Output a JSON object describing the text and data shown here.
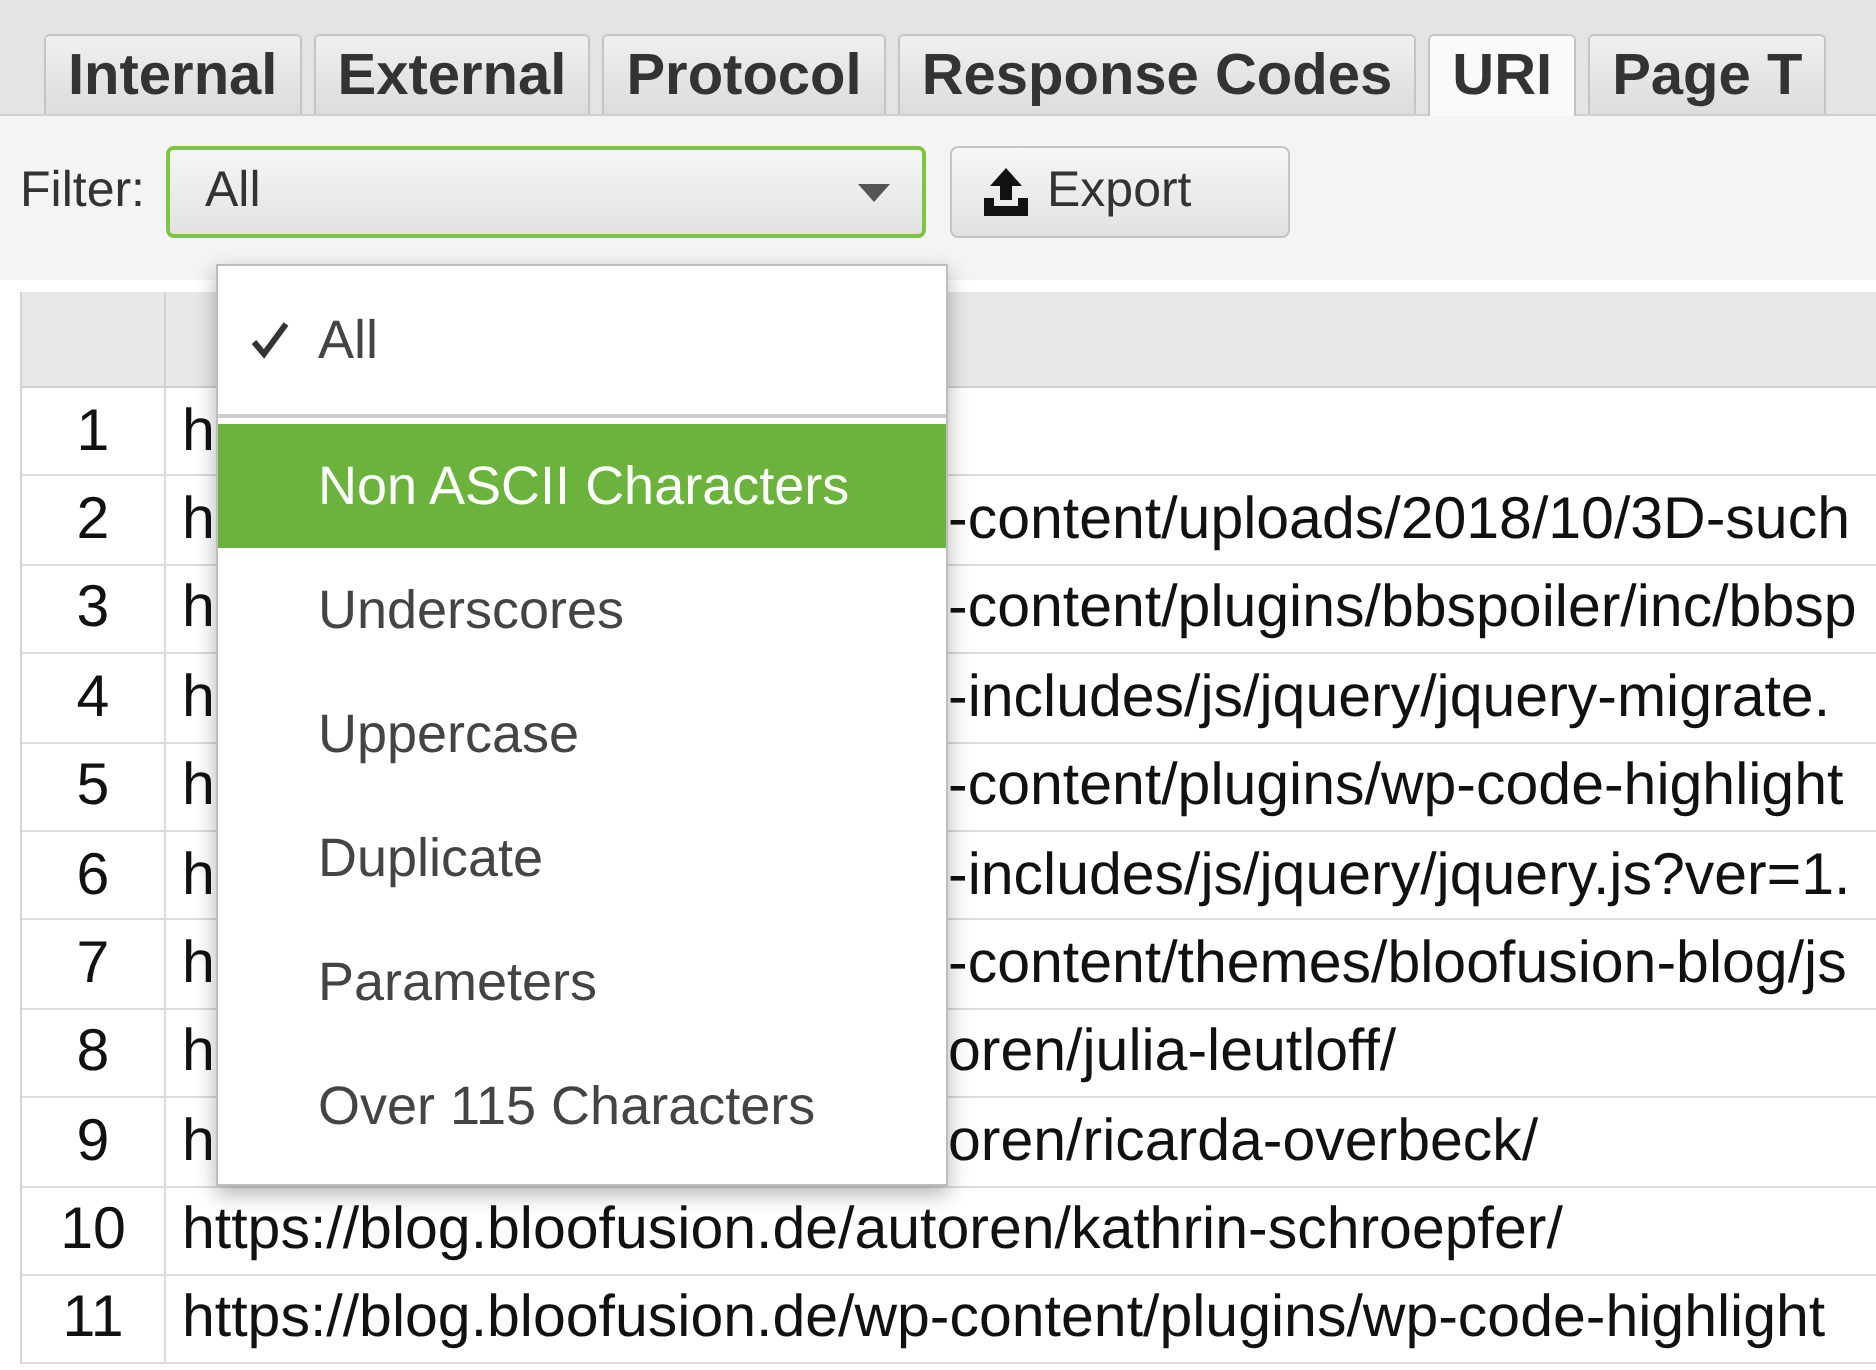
{
  "tabs": [
    {
      "label": "Internal",
      "selected": false
    },
    {
      "label": "External",
      "selected": false
    },
    {
      "label": "Protocol",
      "selected": false
    },
    {
      "label": "Response Codes",
      "selected": false
    },
    {
      "label": "URI",
      "selected": true
    },
    {
      "label": "Page T",
      "selected": false
    }
  ],
  "filter": {
    "label": "Filter:",
    "value": "All",
    "expanded": true
  },
  "export_button": {
    "label": "Export"
  },
  "dropdown": [
    {
      "label": "All",
      "checked": true,
      "selected": false
    },
    {
      "label": "Non ASCII Characters",
      "checked": false,
      "selected": true
    },
    {
      "label": "Underscores",
      "checked": false,
      "selected": false
    },
    {
      "label": "Uppercase",
      "checked": false,
      "selected": false
    },
    {
      "label": "Duplicate",
      "checked": false,
      "selected": false
    },
    {
      "label": "Parameters",
      "checked": false,
      "selected": false
    },
    {
      "label": "Over 115 Characters",
      "checked": false,
      "selected": false
    }
  ],
  "table": {
    "rows": [
      {
        "index": "1",
        "url_start": "h"
      },
      {
        "index": "2",
        "url_start": "h",
        "url_end": "-content/uploads/2018/10/3D-such"
      },
      {
        "index": "3",
        "url_start": "h",
        "url_end": "-content/plugins/bbspoiler/inc/bbsp"
      },
      {
        "index": "4",
        "url_start": "h",
        "url_end": "-includes/js/jquery/jquery-migrate."
      },
      {
        "index": "5",
        "url_start": "h",
        "url_end": "-content/plugins/wp-code-highlight"
      },
      {
        "index": "6",
        "url_start": "h",
        "url_end": "-includes/js/jquery/jquery.js?ver=1."
      },
      {
        "index": "7",
        "url_start": "h",
        "url_end": "-content/themes/bloofusion-blog/js"
      },
      {
        "index": "8",
        "url_start": "h",
        "url_end": "oren/julia-leutloff/"
      },
      {
        "index": "9",
        "url_start": "h",
        "url_end": "oren/ricarda-overbeck/"
      },
      {
        "index": "10",
        "url": "https://blog.bloofusion.de/autoren/kathrin-schroepfer/"
      },
      {
        "index": "11",
        "url": "https://blog.bloofusion.de/wp-content/plugins/wp-code-highlight"
      }
    ]
  }
}
